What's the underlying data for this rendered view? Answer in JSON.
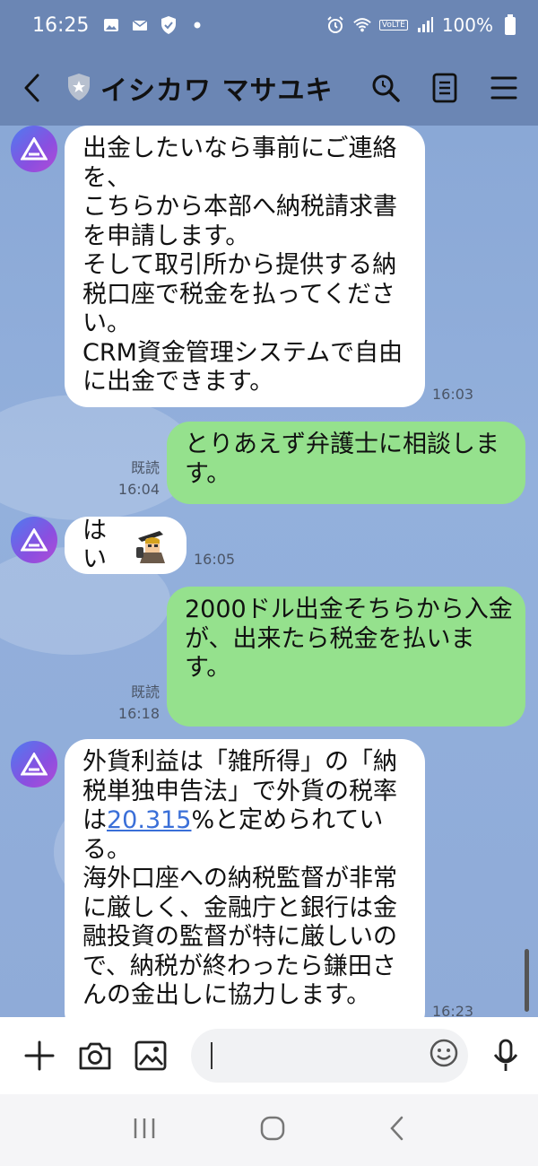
{
  "status_bar": {
    "time": "16:25",
    "battery": "100%",
    "network_tag": "VoLTE"
  },
  "header": {
    "title": "イシカワ マサユキ"
  },
  "messages": [
    {
      "direction": "incoming",
      "lines": [
        "出金したいなら事前にご連絡",
        "を、",
        "こちらから本部へ納税請求書",
        "を申請します。",
        "そして取引所から提供する納",
        "税口座で税金を払ってくださ",
        "い。",
        "CRM資金管理システムで自由",
        "に出金できます。"
      ],
      "time": "16:03"
    },
    {
      "direction": "outgoing",
      "lines": [
        "とりあえず弁護士に相談しま",
        "す。"
      ],
      "read": "既読",
      "time": "16:04"
    },
    {
      "direction": "incoming",
      "text": "はい",
      "sticker": "detective-emoji",
      "time": "16:05"
    },
    {
      "direction": "outgoing",
      "lines": [
        "2000ドル出金そちらから入金",
        "が、出来たら税金を払いま",
        "す。"
      ],
      "read": "既読",
      "time": "16:18"
    },
    {
      "direction": "incoming",
      "line1": "外貨利益は「雑所得」の「納",
      "line2": "税単独申告法」で外貨の税率",
      "line3_prefix": "は",
      "line3_link": "20.315",
      "line3_suffix": "%と定められてい",
      "rest": [
        "る。",
        "海外口座への納税監督が非常",
        "に厳しく、金融庁と銀行は金",
        "融投資の監督が特に厳しいの",
        "で、納税が終わったら鎌田さ",
        "んの金出しに協力します。"
      ],
      "time": "16:23"
    }
  ],
  "input": {
    "value": ""
  },
  "colors": {
    "header_bg": "#6b86b4",
    "chat_bg": "#8aa8d4",
    "outgoing_bubble": "#95e18d",
    "incoming_bubble": "#ffffff",
    "link": "#3a6fd8"
  },
  "icons": [
    "back-icon",
    "shield-icon",
    "search-icon",
    "notes-icon",
    "menu-icon",
    "plus-icon",
    "camera-icon",
    "image-icon",
    "emoji-icon",
    "mic-icon"
  ]
}
